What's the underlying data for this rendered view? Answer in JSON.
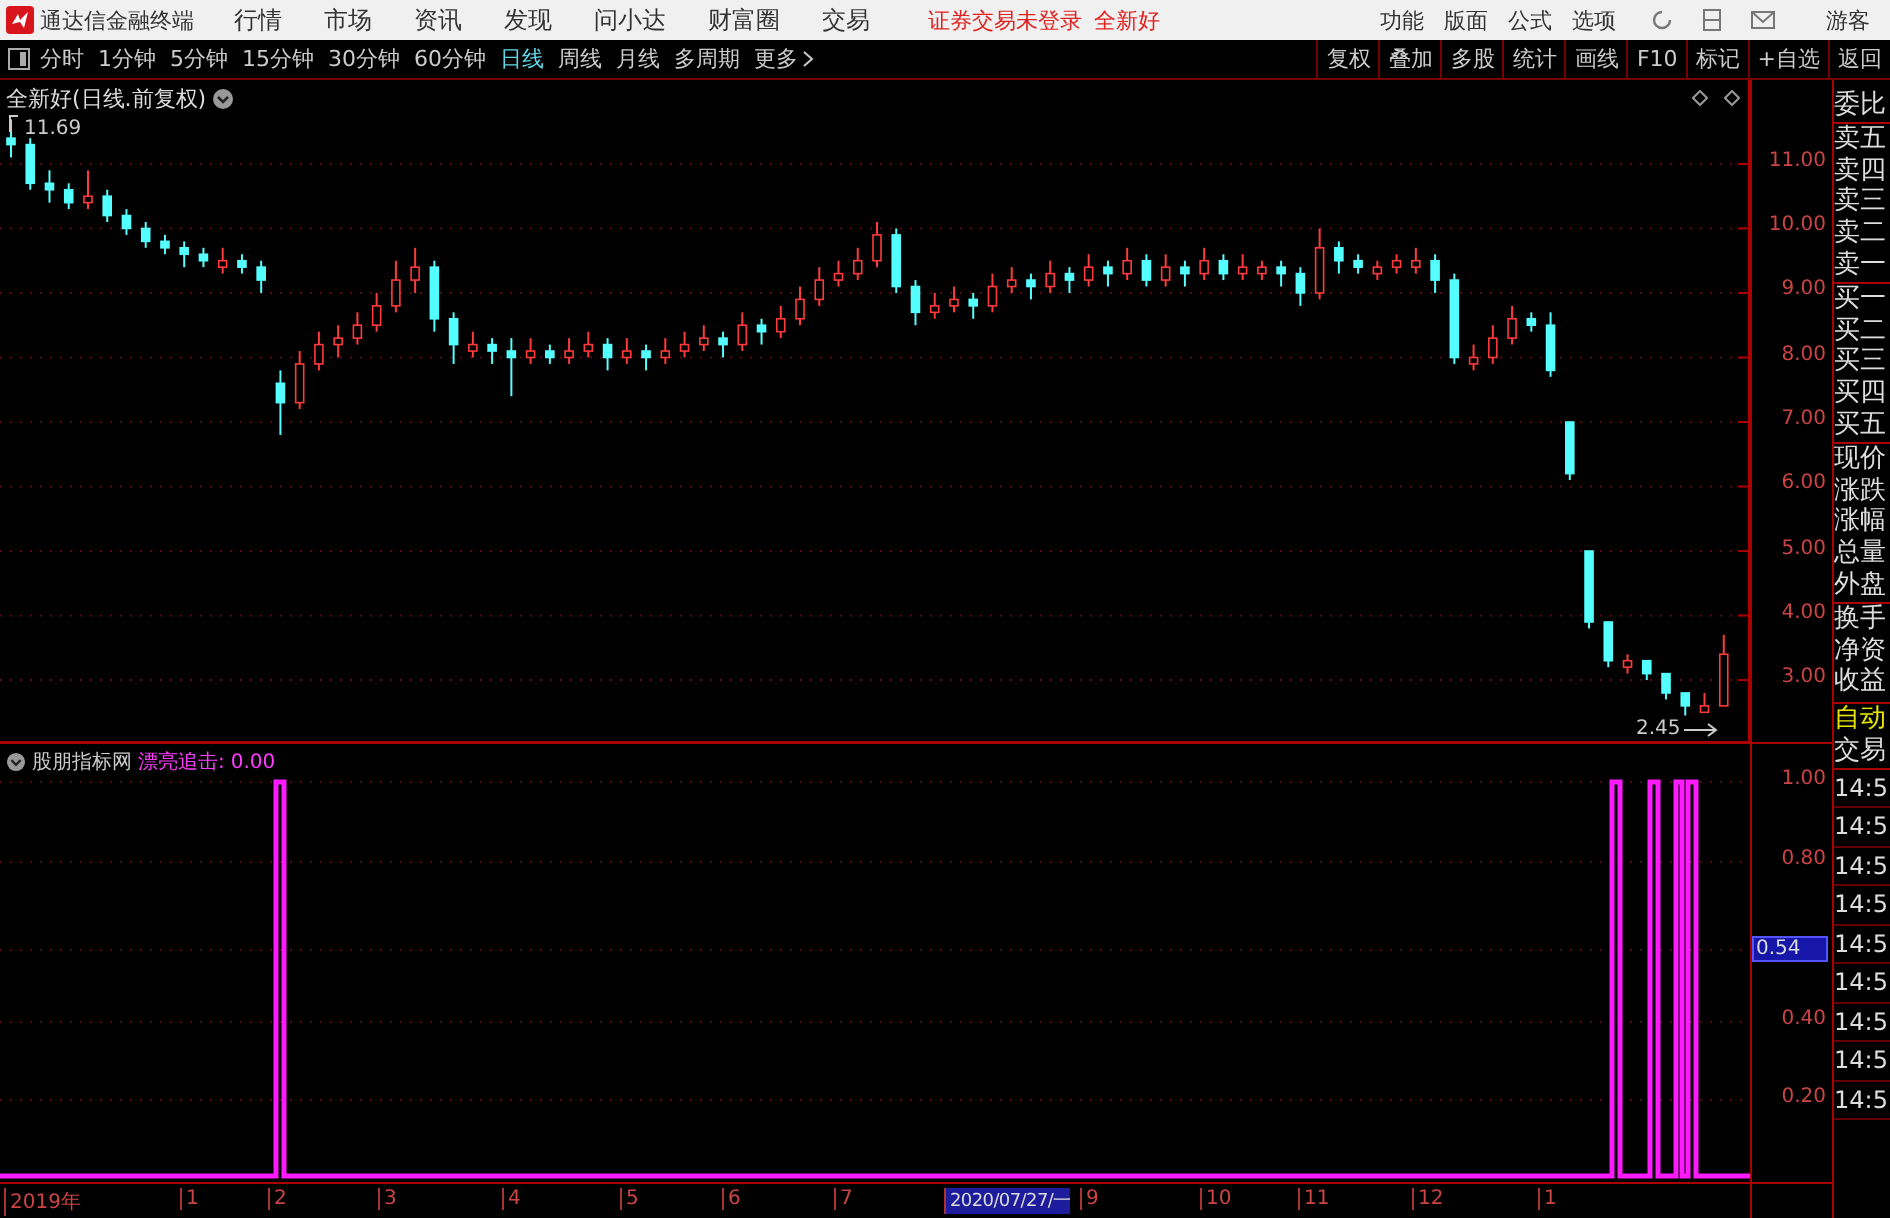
{
  "app": {
    "title": "通达信金融终端",
    "menus": [
      "行情",
      "市场",
      "资讯",
      "发现",
      "问小达",
      "财富圈",
      "交易"
    ],
    "login_status": "证券交易未登录",
    "stock_name": "全新好",
    "menu_right": [
      "功能",
      "版面",
      "公式",
      "选项"
    ],
    "user": "游客"
  },
  "period_tabs": [
    {
      "label": "分时",
      "selected": false
    },
    {
      "label": "1分钟",
      "selected": false
    },
    {
      "label": "5分钟",
      "selected": false
    },
    {
      "label": "15分钟",
      "selected": false
    },
    {
      "label": "30分钟",
      "selected": false
    },
    {
      "label": "60分钟",
      "selected": false
    },
    {
      "label": "日线",
      "selected": true
    },
    {
      "label": "周线",
      "selected": false
    },
    {
      "label": "月线",
      "selected": false
    },
    {
      "label": "多周期",
      "selected": false
    },
    {
      "label": "更多",
      "selected": false
    }
  ],
  "chart_buttons": [
    "复权",
    "叠加",
    "多股",
    "统计",
    "画线",
    "F10",
    "标记",
    "+自选",
    "返回"
  ],
  "price_chart": {
    "title": "全新好(日线.前复权)",
    "high_marker": "11.69",
    "low_marker": "2.45",
    "chart_data": {
      "type": "candlestick",
      "grid": true,
      "ylim": [
        2.04,
        12.27
      ],
      "yticks": [
        {
          "value": 11,
          "label": "11.00"
        },
        {
          "value": 10,
          "label": "10.00"
        },
        {
          "value": 9,
          "label": "9.00"
        },
        {
          "value": 8,
          "label": "8.00"
        },
        {
          "value": 7,
          "label": "7.00"
        },
        {
          "value": 6,
          "label": "6.00"
        },
        {
          "value": 5,
          "label": "5.00"
        },
        {
          "value": 4,
          "label": "4.00"
        },
        {
          "value": 3,
          "label": "3.00"
        }
      ],
      "ohlc": [
        [
          11.4,
          11.69,
          11.1,
          11.3
        ],
        [
          11.3,
          11.4,
          10.6,
          10.7
        ],
        [
          10.7,
          10.9,
          10.4,
          10.6
        ],
        [
          10.6,
          10.7,
          10.3,
          10.4
        ],
        [
          10.4,
          10.9,
          10.3,
          10.5
        ],
        [
          10.5,
          10.6,
          10.1,
          10.2
        ],
        [
          10.2,
          10.3,
          9.9,
          10.0
        ],
        [
          10.0,
          10.1,
          9.7,
          9.8
        ],
        [
          9.8,
          9.9,
          9.6,
          9.7
        ],
        [
          9.7,
          9.8,
          9.4,
          9.6
        ],
        [
          9.6,
          9.7,
          9.4,
          9.5
        ],
        [
          9.4,
          9.7,
          9.3,
          9.5
        ],
        [
          9.5,
          9.6,
          9.3,
          9.4
        ],
        [
          9.4,
          9.5,
          9.0,
          9.2
        ],
        [
          7.6,
          7.8,
          6.8,
          7.3
        ],
        [
          7.3,
          8.1,
          7.2,
          7.9
        ],
        [
          7.9,
          8.4,
          7.8,
          8.2
        ],
        [
          8.2,
          8.5,
          8.0,
          8.3
        ],
        [
          8.3,
          8.7,
          8.2,
          8.5
        ],
        [
          8.5,
          9.0,
          8.4,
          8.8
        ],
        [
          8.8,
          9.5,
          8.7,
          9.2
        ],
        [
          9.2,
          9.7,
          9.0,
          9.4
        ],
        [
          9.4,
          9.5,
          8.4,
          8.6
        ],
        [
          8.6,
          8.7,
          7.9,
          8.2
        ],
        [
          8.1,
          8.4,
          8.0,
          8.2
        ],
        [
          8.2,
          8.3,
          7.9,
          8.1
        ],
        [
          8.1,
          8.3,
          7.4,
          8.0
        ],
        [
          8.0,
          8.3,
          7.9,
          8.1
        ],
        [
          8.1,
          8.2,
          7.9,
          8.0
        ],
        [
          8.0,
          8.3,
          7.9,
          8.1
        ],
        [
          8.1,
          8.4,
          8.0,
          8.2
        ],
        [
          8.2,
          8.3,
          7.8,
          8.0
        ],
        [
          8.0,
          8.3,
          7.9,
          8.1
        ],
        [
          8.1,
          8.2,
          7.8,
          8.0
        ],
        [
          8.0,
          8.3,
          7.9,
          8.1
        ],
        [
          8.1,
          8.4,
          8.0,
          8.2
        ],
        [
          8.2,
          8.5,
          8.1,
          8.3
        ],
        [
          8.3,
          8.4,
          8.0,
          8.2
        ],
        [
          8.2,
          8.7,
          8.1,
          8.5
        ],
        [
          8.5,
          8.6,
          8.2,
          8.4
        ],
        [
          8.4,
          8.8,
          8.3,
          8.6
        ],
        [
          8.6,
          9.1,
          8.5,
          8.9
        ],
        [
          8.9,
          9.4,
          8.8,
          9.2
        ],
        [
          9.2,
          9.5,
          9.1,
          9.3
        ],
        [
          9.3,
          9.7,
          9.2,
          9.5
        ],
        [
          9.5,
          10.1,
          9.4,
          9.9
        ],
        [
          9.9,
          10.0,
          9.0,
          9.1
        ],
        [
          9.1,
          9.2,
          8.5,
          8.7
        ],
        [
          8.7,
          9.0,
          8.6,
          8.8
        ],
        [
          8.8,
          9.1,
          8.7,
          8.9
        ],
        [
          8.9,
          9.0,
          8.6,
          8.8
        ],
        [
          8.8,
          9.3,
          8.7,
          9.1
        ],
        [
          9.1,
          9.4,
          9.0,
          9.2
        ],
        [
          9.2,
          9.3,
          8.9,
          9.1
        ],
        [
          9.1,
          9.5,
          9.0,
          9.3
        ],
        [
          9.3,
          9.4,
          9.0,
          9.2
        ],
        [
          9.2,
          9.6,
          9.1,
          9.4
        ],
        [
          9.4,
          9.5,
          9.1,
          9.3
        ],
        [
          9.3,
          9.7,
          9.2,
          9.5
        ],
        [
          9.5,
          9.6,
          9.1,
          9.2
        ],
        [
          9.2,
          9.6,
          9.1,
          9.4
        ],
        [
          9.4,
          9.5,
          9.1,
          9.3
        ],
        [
          9.3,
          9.7,
          9.2,
          9.5
        ],
        [
          9.5,
          9.6,
          9.2,
          9.3
        ],
        [
          9.3,
          9.6,
          9.2,
          9.4
        ],
        [
          9.3,
          9.5,
          9.2,
          9.4
        ],
        [
          9.4,
          9.5,
          9.1,
          9.3
        ],
        [
          9.3,
          9.4,
          8.8,
          9.0
        ],
        [
          9.0,
          10.0,
          8.9,
          9.7
        ],
        [
          9.7,
          9.8,
          9.3,
          9.5
        ],
        [
          9.5,
          9.6,
          9.3,
          9.4
        ],
        [
          9.3,
          9.5,
          9.2,
          9.4
        ],
        [
          9.4,
          9.6,
          9.3,
          9.5
        ],
        [
          9.4,
          9.7,
          9.3,
          9.5
        ],
        [
          9.5,
          9.6,
          9.0,
          9.2
        ],
        [
          9.2,
          9.3,
          7.9,
          8.0
        ],
        [
          7.9,
          8.2,
          7.8,
          8.0
        ],
        [
          8.0,
          8.5,
          7.9,
          8.3
        ],
        [
          8.3,
          8.8,
          8.2,
          8.6
        ],
        [
          8.6,
          8.7,
          8.4,
          8.5
        ],
        [
          8.5,
          8.7,
          7.7,
          7.8
        ],
        [
          7.0,
          7.0,
          6.1,
          6.2
        ],
        [
          5.0,
          5.0,
          3.8,
          3.9
        ],
        [
          3.9,
          3.9,
          3.2,
          3.3
        ],
        [
          3.2,
          3.4,
          3.1,
          3.3
        ],
        [
          3.3,
          3.3,
          3.0,
          3.1
        ],
        [
          3.1,
          3.1,
          2.7,
          2.8
        ],
        [
          2.8,
          2.8,
          2.45,
          2.6
        ],
        [
          2.5,
          2.8,
          2.5,
          2.6
        ],
        [
          2.6,
          3.7,
          2.6,
          3.4
        ]
      ]
    }
  },
  "indicator": {
    "source": "股朋指标网",
    "name": "漂亮追击:",
    "value": "0.00",
    "axis_labels": [
      {
        "text": "1.00",
        "highlighted": false
      },
      {
        "text": "0.80",
        "highlighted": false
      },
      {
        "text": "0.54",
        "highlighted": true
      },
      {
        "text": "0.40",
        "highlighted": false
      },
      {
        "text": "0.20",
        "highlighted": false
      }
    ]
  },
  "date_axis": [
    {
      "label": "2019年",
      "highlighted": false
    },
    {
      "label": "1",
      "highlighted": false
    },
    {
      "label": "2",
      "highlighted": false
    },
    {
      "label": "3",
      "highlighted": false
    },
    {
      "label": "4",
      "highlighted": false
    },
    {
      "label": "5",
      "highlighted": false
    },
    {
      "label": "6",
      "highlighted": false
    },
    {
      "label": "7",
      "highlighted": false
    },
    {
      "label": "2020/07/27/一",
      "highlighted": true
    },
    {
      "label": "9",
      "highlighted": false
    },
    {
      "label": "10",
      "highlighted": false
    },
    {
      "label": "11",
      "highlighted": false
    },
    {
      "label": "12",
      "highlighted": false
    },
    {
      "label": "1",
      "highlighted": false
    }
  ],
  "quote_panel": {
    "labels": [
      "委比",
      "卖五",
      "卖四",
      "卖三",
      "卖二",
      "卖一",
      "买一",
      "买二",
      "买三",
      "买四",
      "买五",
      "现价",
      "涨跌",
      "涨幅",
      "总量",
      "外盘",
      "换手",
      "净资",
      "收益"
    ],
    "mode": "自动",
    "trade": "交易",
    "times": [
      "14:5",
      "14:5",
      "14:5",
      "14:5",
      "14:5",
      "14:5",
      "14:5",
      "14:5",
      "14:5"
    ]
  }
}
